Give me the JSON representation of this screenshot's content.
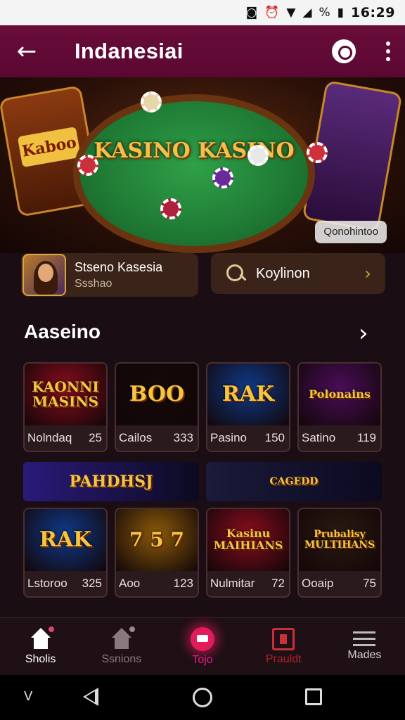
{
  "status_bar": {
    "time": "16:29",
    "percent_symbol": "%"
  },
  "app_bar": {
    "title": "Indanesiai"
  },
  "hero": {
    "title": "KASINO KASINO",
    "pill_label": "Qonohintoo",
    "left_machine_text": "Kaboo"
  },
  "info_card": {
    "title": "Stseno Kasesia",
    "subtitle": "Ssshao"
  },
  "search_card": {
    "label": "Koylinon"
  },
  "section": {
    "title": "Aaseino"
  },
  "games_row1": [
    {
      "art": "KAONNI MASINS",
      "name": "Nolndaq",
      "count": "25",
      "bg": "#8a0d1e"
    },
    {
      "art": "BOO",
      "name": "Cailos",
      "count": "333",
      "bg": "#140a06"
    },
    {
      "art": "RAK",
      "name": "Pasino",
      "count": "150",
      "bg": "#0f3a8a"
    },
    {
      "art": "Polonains",
      "name": "Satino",
      "count": "119",
      "bg": "#4a0d5a"
    }
  ],
  "banners": [
    {
      "text": "PAHDHSJ",
      "bg": "#2a1a7a"
    },
    {
      "text": "CAGEDD",
      "bg": "#1a1a3a"
    }
  ],
  "games_row2": [
    {
      "art": "RAK",
      "name": "Lstoroo",
      "count": "325",
      "bg": "#0f3a8a"
    },
    {
      "art": "7 5 7",
      "name": "Aoo",
      "count": "123",
      "bg": "#8a5a0a"
    },
    {
      "art": "Kasinu MAIHIANS",
      "name": "Nulmitar",
      "count": "72",
      "bg": "#8a0d1e"
    },
    {
      "art": "Prubalisy MULTIHANS",
      "name": "Ooaip",
      "count": "75",
      "bg": "#2a1a10"
    }
  ],
  "bottom_nav": [
    {
      "label": "Sholis",
      "color": "#ffffff"
    },
    {
      "label": "Ssnions",
      "color": "#8a7a80"
    },
    {
      "label": "Tojo",
      "color": "#e21b8a"
    },
    {
      "label": "Prauldt",
      "color": "#b0202c"
    },
    {
      "label": "Mades",
      "color": "#cfcfcf"
    }
  ],
  "system_nav": {
    "left_glyph": "V"
  }
}
